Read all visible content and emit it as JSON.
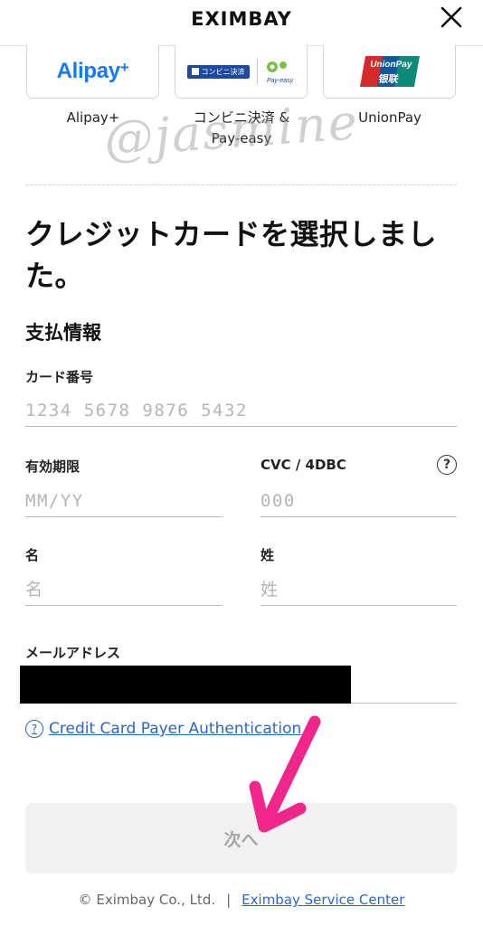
{
  "header": {
    "logo": "EXIMBAY"
  },
  "payment_methods": [
    {
      "label": "Alipay+",
      "logo_text": "Alipay",
      "logo_plus": "+"
    },
    {
      "label_line1": "コンビニ決済 &",
      "label_line2": "Pay-easy",
      "badge_text": "コンビニ決済",
      "payeasy_text": "Pay-easy"
    },
    {
      "label": "UnionPay",
      "logo_en": "UnionPay",
      "logo_cn": "银联"
    }
  ],
  "watermark": "@jasmine",
  "main": {
    "title": "クレジットカードを選択しました。",
    "section_title": "支払情報"
  },
  "form": {
    "card_number": {
      "label": "カード番号",
      "placeholder": "1234 5678 9876 5432"
    },
    "expiry": {
      "label": "有効期限",
      "placeholder": "MM/YY"
    },
    "cvc": {
      "label": "CVC / 4DBC",
      "placeholder": "000"
    },
    "first_name": {
      "label": "名",
      "placeholder": "名"
    },
    "last_name": {
      "label": "姓",
      "placeholder": "姓"
    },
    "email": {
      "label": "メールアドレス"
    }
  },
  "auth_link": "Credit Card Payer Authentication",
  "next_button": "次へ",
  "footer": {
    "copyright": "© Eximbay Co., Ltd.",
    "separator": "|",
    "service_link": "Eximbay Service Center"
  },
  "colors": {
    "accent_link": "#2a66c9",
    "annotation_arrow": "#f0268a",
    "alipay_blue": "#1677ff"
  }
}
